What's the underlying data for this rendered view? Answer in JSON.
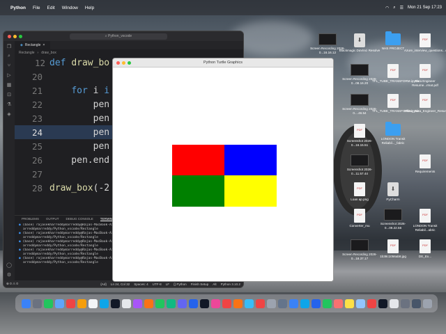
{
  "menubar": {
    "apple": "",
    "items": [
      "Python",
      "File",
      "Edit",
      "Window",
      "Help"
    ],
    "datetime": "Mon 21 Sep  17:23"
  },
  "vscode": {
    "search": "Python_vscode",
    "tab": "Rectangle",
    "breadcrumb": [
      "Rectangle",
      "draw_box"
    ],
    "code_lines": [
      {
        "n": "12",
        "text": "def draw_bo"
      },
      {
        "n": "20",
        "text": ""
      },
      {
        "n": "21",
        "text": "    for i i"
      },
      {
        "n": "22",
        "text": "        pen"
      },
      {
        "n": "23",
        "text": "        pen"
      },
      {
        "n": "24",
        "text": "        pen"
      },
      {
        "n": "25",
        "text": "        pen"
      },
      {
        "n": "26",
        "text": "    pen.end"
      },
      {
        "n": "27",
        "text": ""
      },
      {
        "n": "28",
        "text": "draw_box(-2"
      }
    ],
    "panel_tabs": [
      "PROBLEMS",
      "OUTPUT",
      "DEBUG CONSOLE",
      "TERMINAL"
    ],
    "terminal_lines": [
      "(base) rajasekharreddymarreddy@Rajas-MacBook-Air F",
      "arreddymarreddy/Python_vscode/Rectangle",
      "(base) rajasekharreddymarreddy@Rajas-MacBook-Air F",
      "arreddymarreddy/Python_vscode/Rectangle",
      "(base) rajasekharreddymarreddy@Rajas-MacBook-Air F",
      "arreddymarreddy/Python_vscode/Rectangle",
      "(base) rajasekharreddymarreddy@Rajas-MacBook-Air F",
      "arreddymarreddy/Python_vscode/Rectangle",
      "(base) rajasekharreddymarreddy@Rajas-MacBook-Air F",
      "arreddymarreddy/Python_vscode/Rectangle"
    ],
    "status_left": "⊗ 0 ⚠ 0",
    "status_right": [
      "{Ad}",
      "Ln 24, Col 32",
      "Spaces: 4",
      "UTF-8",
      "LF",
      "{} Python",
      "Finish Setup",
      "Alt",
      "Python 3.10.2"
    ]
  },
  "turtle": {
    "title": "Python Turtle Graphics",
    "colors": {
      "top_left": "#ff0000",
      "top_right": "#0000ff",
      "bottom_left": "#008000",
      "bottom_right": "#ffff00"
    }
  },
  "desktop_icons": [
    {
      "label": "Screen Recording 2026-0...16.16.12",
      "kind": "shot"
    },
    {
      "label": "Blackmagic DaVinci Resolve",
      "kind": "dmg"
    },
    {
      "label": "NHS PROJECT",
      "kind": "folder"
    },
    {
      "label": "Azure_interview_questions...410.pdf",
      "kind": "file"
    },
    {
      "label": "Screen Recording 2026-0...08.16.20",
      "kind": "shot"
    },
    {
      "label": "TFL_TUBE_TRANSFORM.ipynb",
      "kind": "file"
    },
    {
      "label": "Data Engineer Resume...rmat.pdf",
      "kind": "file"
    },
    {
      "label": "Screen Recording 2026-0....46.54",
      "kind": "shot"
    },
    {
      "label": "TFL_TUBE_TRANSFORM.ipynb",
      "kind": "file"
    },
    {
      "label": "Dilbar_Data_Engineer_Resume.pdf",
      "kind": "file"
    },
    {
      "label": "Screenshot 2026-0...16.15.51",
      "kind": "file"
    },
    {
      "label": "LONDON Transit Reliabil..._fabric",
      "kind": "folder"
    },
    {
      "label": "Screenshot 2026-0...11.57.44",
      "kind": "shot"
    },
    {
      "label": "Requirements",
      "kind": "file"
    },
    {
      "label": "Loan ap.png",
      "kind": "file"
    },
    {
      "label": "PyCharm",
      "kind": "dmg"
    },
    {
      "label": "Converter_mu",
      "kind": "file"
    },
    {
      "label": "Screenshot 2026-0...09.22.56",
      "kind": "shot"
    },
    {
      "label": "LONDON Transit Reliabil...abric",
      "kind": "file"
    },
    {
      "label": "Screen Recording 2026-0...18.37.17",
      "kind": "shot"
    },
    {
      "label": "1b38c1056ab8.jpg",
      "kind": "file"
    },
    {
      "label": "DE_Ex...",
      "kind": "file"
    }
  ],
  "dock_colors": [
    "#3b82f6",
    "#6b7280",
    "#22c55e",
    "#60a5fa",
    "#ef4444",
    "#f59e0b",
    "#f3f4f6",
    "#0ea5e9",
    "#111827",
    "#e5e7eb",
    "#a855f7",
    "#f97316",
    "#22c55e",
    "#10b981",
    "#6366f1",
    "#2563eb",
    "#111827",
    "#ec4899",
    "#ef4444",
    "#f97316",
    "#38bdf8",
    "#ef4444",
    "#9ca3af",
    "#64748b",
    "#3b82f6",
    "#0ea5e9",
    "#2563eb",
    "#22c55e",
    "#f87171",
    "#fde047",
    "#93c5fd",
    "#ef4444",
    "#111827",
    "#e5e7eb",
    "#6b7280",
    "#475569",
    "#9ca3af"
  ]
}
